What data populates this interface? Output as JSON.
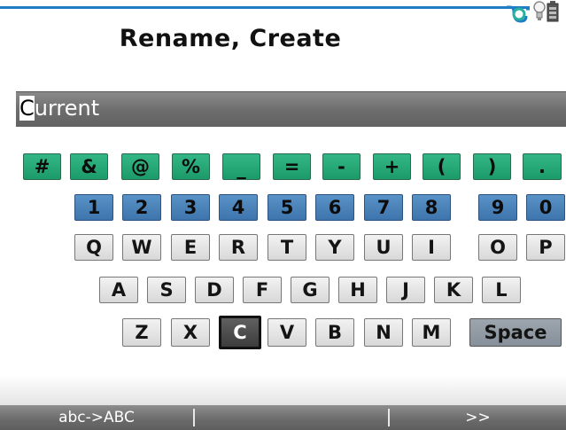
{
  "title": "Rename, Create",
  "name_field": {
    "cursor_char": "C",
    "rest": "urrent"
  },
  "keyboard": {
    "symbols": [
      "#",
      "&",
      "@",
      "%",
      "_",
      "=",
      "-",
      "+",
      "(",
      ")",
      "."
    ],
    "numbers": [
      "1",
      "2",
      "3",
      "4",
      "5",
      "6",
      "7",
      "8",
      "9",
      "0"
    ],
    "row_q": [
      "Q",
      "W",
      "E",
      "R",
      "T",
      "Y",
      "U",
      "I",
      "O",
      "P"
    ],
    "row_a": [
      "A",
      "S",
      "D",
      "F",
      "G",
      "H",
      "J",
      "K",
      "L"
    ],
    "row_z": [
      "Z",
      "X",
      "C",
      "V",
      "B",
      "N",
      "M"
    ],
    "space_label": "Space",
    "selected_key": "C"
  },
  "softkeys": {
    "left": "abc->ABC",
    "middle": "",
    "right": ">>"
  },
  "colors": {
    "accent_line": "#1f7dc4",
    "symbol_key": "#1c9b6a",
    "number_key": "#3d74ac"
  },
  "icons": [
    "link-icon",
    "bulb-icon",
    "battery-icon"
  ]
}
